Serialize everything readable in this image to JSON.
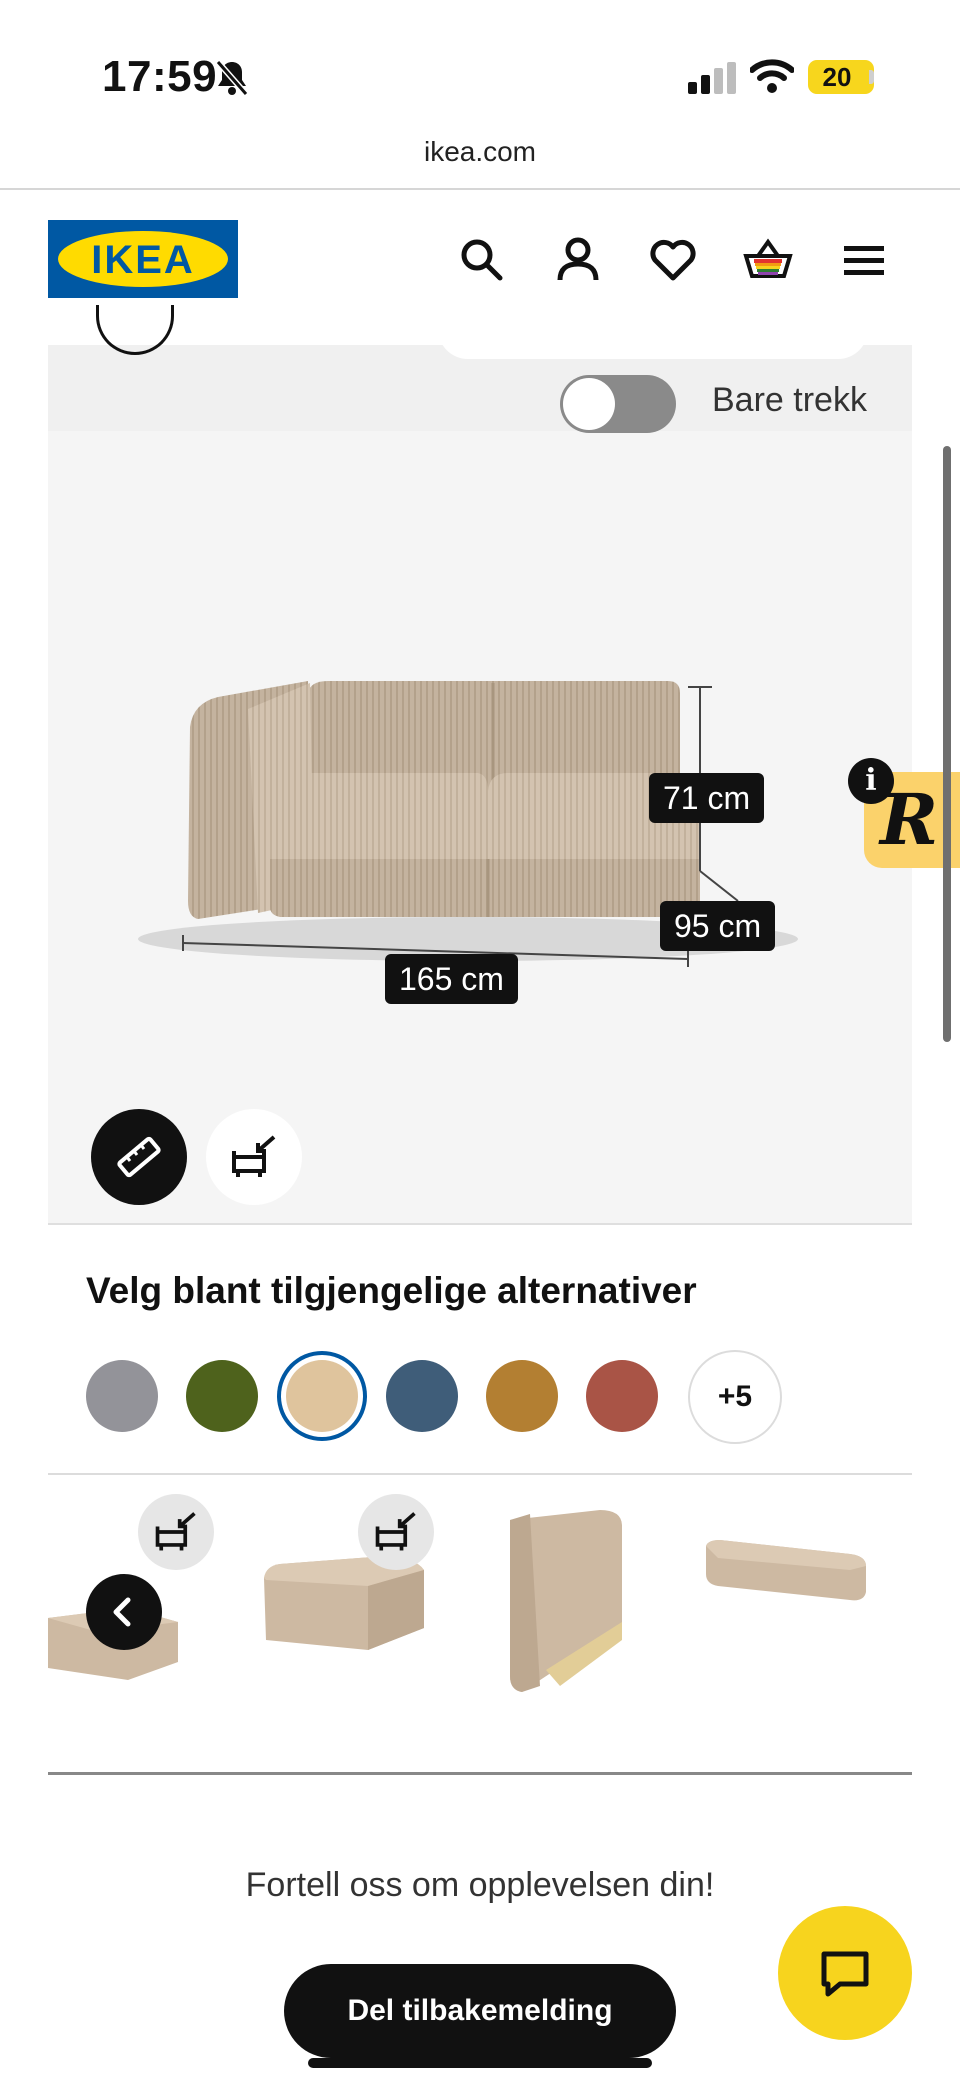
{
  "status_bar": {
    "time": "17:59",
    "battery": "20",
    "icons": [
      "bell-slash-icon",
      "cellular-signal-icon",
      "wifi-icon",
      "battery-icon"
    ]
  },
  "browser": {
    "url": "ikea.com"
  },
  "header": {
    "logo_text": "IKEA",
    "icons": [
      "search-icon",
      "account-icon",
      "heart-icon",
      "basket-icon",
      "menu-icon"
    ],
    "brand_colors": {
      "blue": "#0058a3",
      "yellow": "#ffdb00"
    }
  },
  "product_view": {
    "toggle_label": "Bare trekk",
    "toggle_on": false,
    "dimensions": {
      "height": "71 cm",
      "depth": "95 cm",
      "width": "165 cm"
    },
    "view_buttons": [
      "ruler-icon",
      "sofa-arrow-icon"
    ]
  },
  "options": {
    "title": "Velg blant tilgjengelige alternativer",
    "swatches": [
      {
        "color": "#939399",
        "selected": false
      },
      {
        "color": "#4e621c",
        "selected": false
      },
      {
        "color": "#dfc49d",
        "selected": true
      },
      {
        "color": "#3f5d79",
        "selected": false
      },
      {
        "color": "#b37f32",
        "selected": false
      },
      {
        "color": "#a95446",
        "selected": false
      }
    ],
    "more_label": "+5"
  },
  "carousel": {
    "items": [
      "sofa-module-partial",
      "corner-seat-module",
      "backrest-module",
      "cushion-module"
    ]
  },
  "feedback": {
    "prompt": "Fortell oss om opplevelsen din!",
    "button_label": "Del tilbakemelding"
  },
  "floating_badge": {
    "letter": "R",
    "info": "i"
  }
}
